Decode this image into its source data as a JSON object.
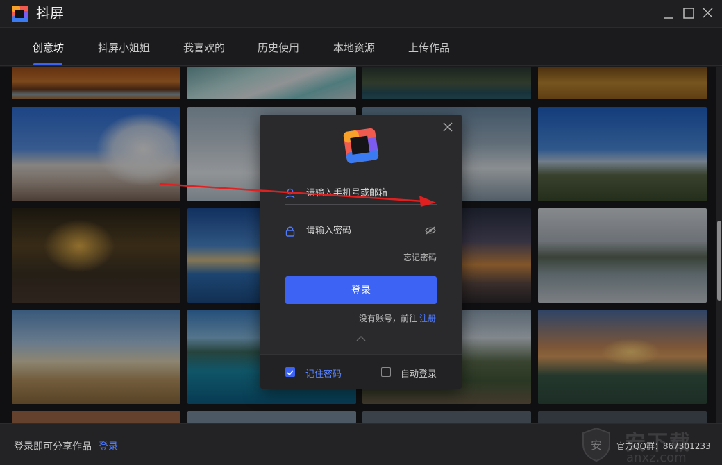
{
  "app": {
    "title": "抖屏"
  },
  "tabs": [
    {
      "label": "创意坊",
      "active": true
    },
    {
      "label": "抖屏小姐姐"
    },
    {
      "label": "我喜欢的"
    },
    {
      "label": "历史使用"
    },
    {
      "label": "本地资源"
    },
    {
      "label": "上传作品"
    }
  ],
  "gallery": {
    "thumbnails": [
      "canyon-river",
      "turquoise-hot-springs",
      "coastal-cliffs",
      "desert-dunes",
      "geyser-steam-blue-sky",
      "snowy-forest",
      "sea-of-clouds",
      "snowcapped-volcano",
      "city-night-intersection",
      "lakeside-harbor-town",
      "mountain-dusk",
      "mountain-lake-reflection",
      "savanna-lone-tree",
      "tropical-bay",
      "green-coastline",
      "cable-car-bay-sunset"
    ]
  },
  "login_dialog": {
    "username_placeholder": "请输入手机号或邮箱",
    "password_placeholder": "请输入密码",
    "forgot_password": "忘记密码",
    "login_button": "登录",
    "no_account": "没有账号，前往",
    "register_link": "注册",
    "remember_password": "记住密码",
    "remember_checked": true,
    "auto_login": "自动登录",
    "auto_login_checked": false
  },
  "footer": {
    "prompt": "登录即可分享作品",
    "login_link": "登录",
    "qq_group": "官方QQ群：867301233",
    "watermark_badge": "安",
    "watermark_text": "安下载",
    "watermark_url": "anxz.com"
  },
  "colors": {
    "accent": "#3d63f5",
    "link": "#4f7bff",
    "background": "#1b1b1d",
    "dialog": "#2a2a2d",
    "annotation_arrow": "#e02020"
  }
}
